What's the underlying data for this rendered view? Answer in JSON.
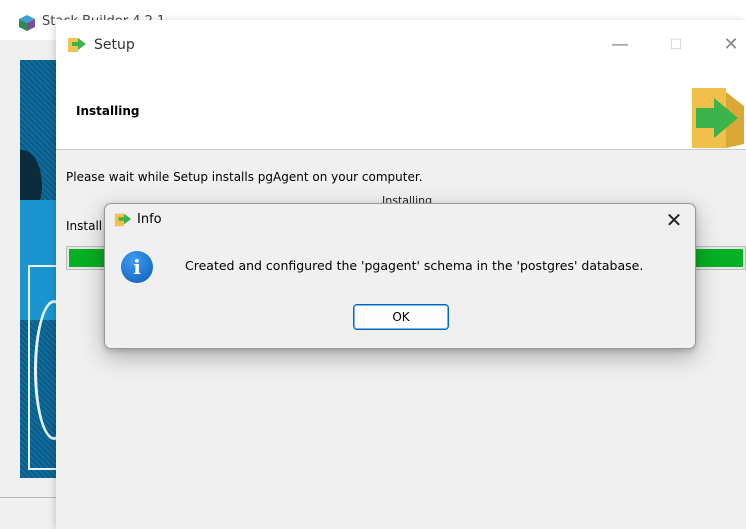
{
  "background_window": {
    "title": "Stack Builder 4.2.1"
  },
  "setup": {
    "title": "Setup",
    "heading": "Installing",
    "body_text": "Please wait while Setup installs pgAgent on your computer.",
    "installing_label": "Installing",
    "install_label": "Install",
    "progress": 1.0,
    "progress_color": "#06b025"
  },
  "dialog": {
    "title": "Info",
    "message": "Created and configured the 'pgagent' schema in the 'postgres' database.",
    "ok_label": "OK",
    "icon": "info-icon",
    "close_icon": "close-icon"
  },
  "colors": {
    "accent": "#0067c0",
    "info_blue": "#1565c0"
  }
}
